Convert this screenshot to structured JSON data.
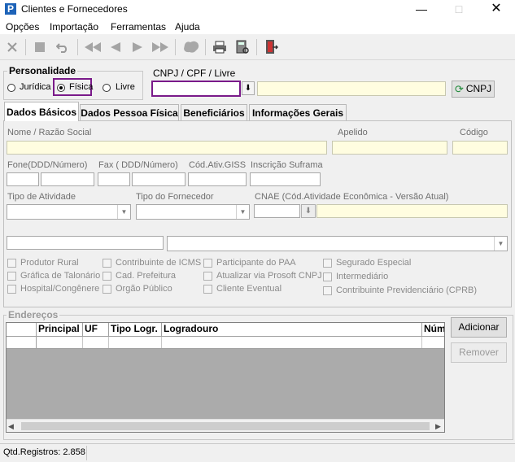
{
  "window": {
    "title": "Clientes e Fornecedores",
    "app_icon": "P"
  },
  "menu": [
    "Opções",
    "Importação",
    "Ferramentas",
    "Ajuda"
  ],
  "personalidade": {
    "title": "Personalidade",
    "options": [
      "Jurídica",
      "Física",
      "Livre"
    ],
    "selected": "Física"
  },
  "cnpj": {
    "label": "CNPJ / CPF / Livre",
    "value": "",
    "button": "CNPJ"
  },
  "tabs": [
    "Dados Básicos",
    "Dados Pessoa Física",
    "Beneficiários",
    "Informações Gerais"
  ],
  "fields": {
    "nome": "Nome / Razão Social",
    "apelido": "Apelido",
    "codigo": "Código",
    "fone": "Fone(DDD/Número)",
    "fax": "Fax ( DDD/Número)",
    "giss": "Cód.Ativ.GISS",
    "suframa": "Inscrição Suframa",
    "tipo_atividade": "Tipo de Atividade",
    "tipo_fornecedor": "Tipo do Fornecedor",
    "cnae": "CNAE (Cód.Atividade Econômica - Versão Atual)"
  },
  "checkboxes": {
    "col1": [
      "Produtor Rural",
      "Gráfica de Talonário",
      "Hospital/Congênere"
    ],
    "col2": [
      "Contribuinte de ICMS",
      "Cad. Prefeitura",
      "Orgão Público"
    ],
    "col3": [
      "Participante do PAA",
      "Atualizar via Prosoft CNPJ",
      "Cliente Eventual"
    ],
    "col4": [
      "Segurado Especial",
      "Intermediário",
      "Contribuinte Previdenciário (CPRB)"
    ]
  },
  "enderecos": {
    "title": "Endereços",
    "columns": [
      "Principal",
      "UF",
      "Tipo Logr.",
      "Logradouro",
      "Núm"
    ],
    "add_button": "Adicionar",
    "remove_button": "Remover"
  },
  "status": "Qtd.Registros: 2.858"
}
